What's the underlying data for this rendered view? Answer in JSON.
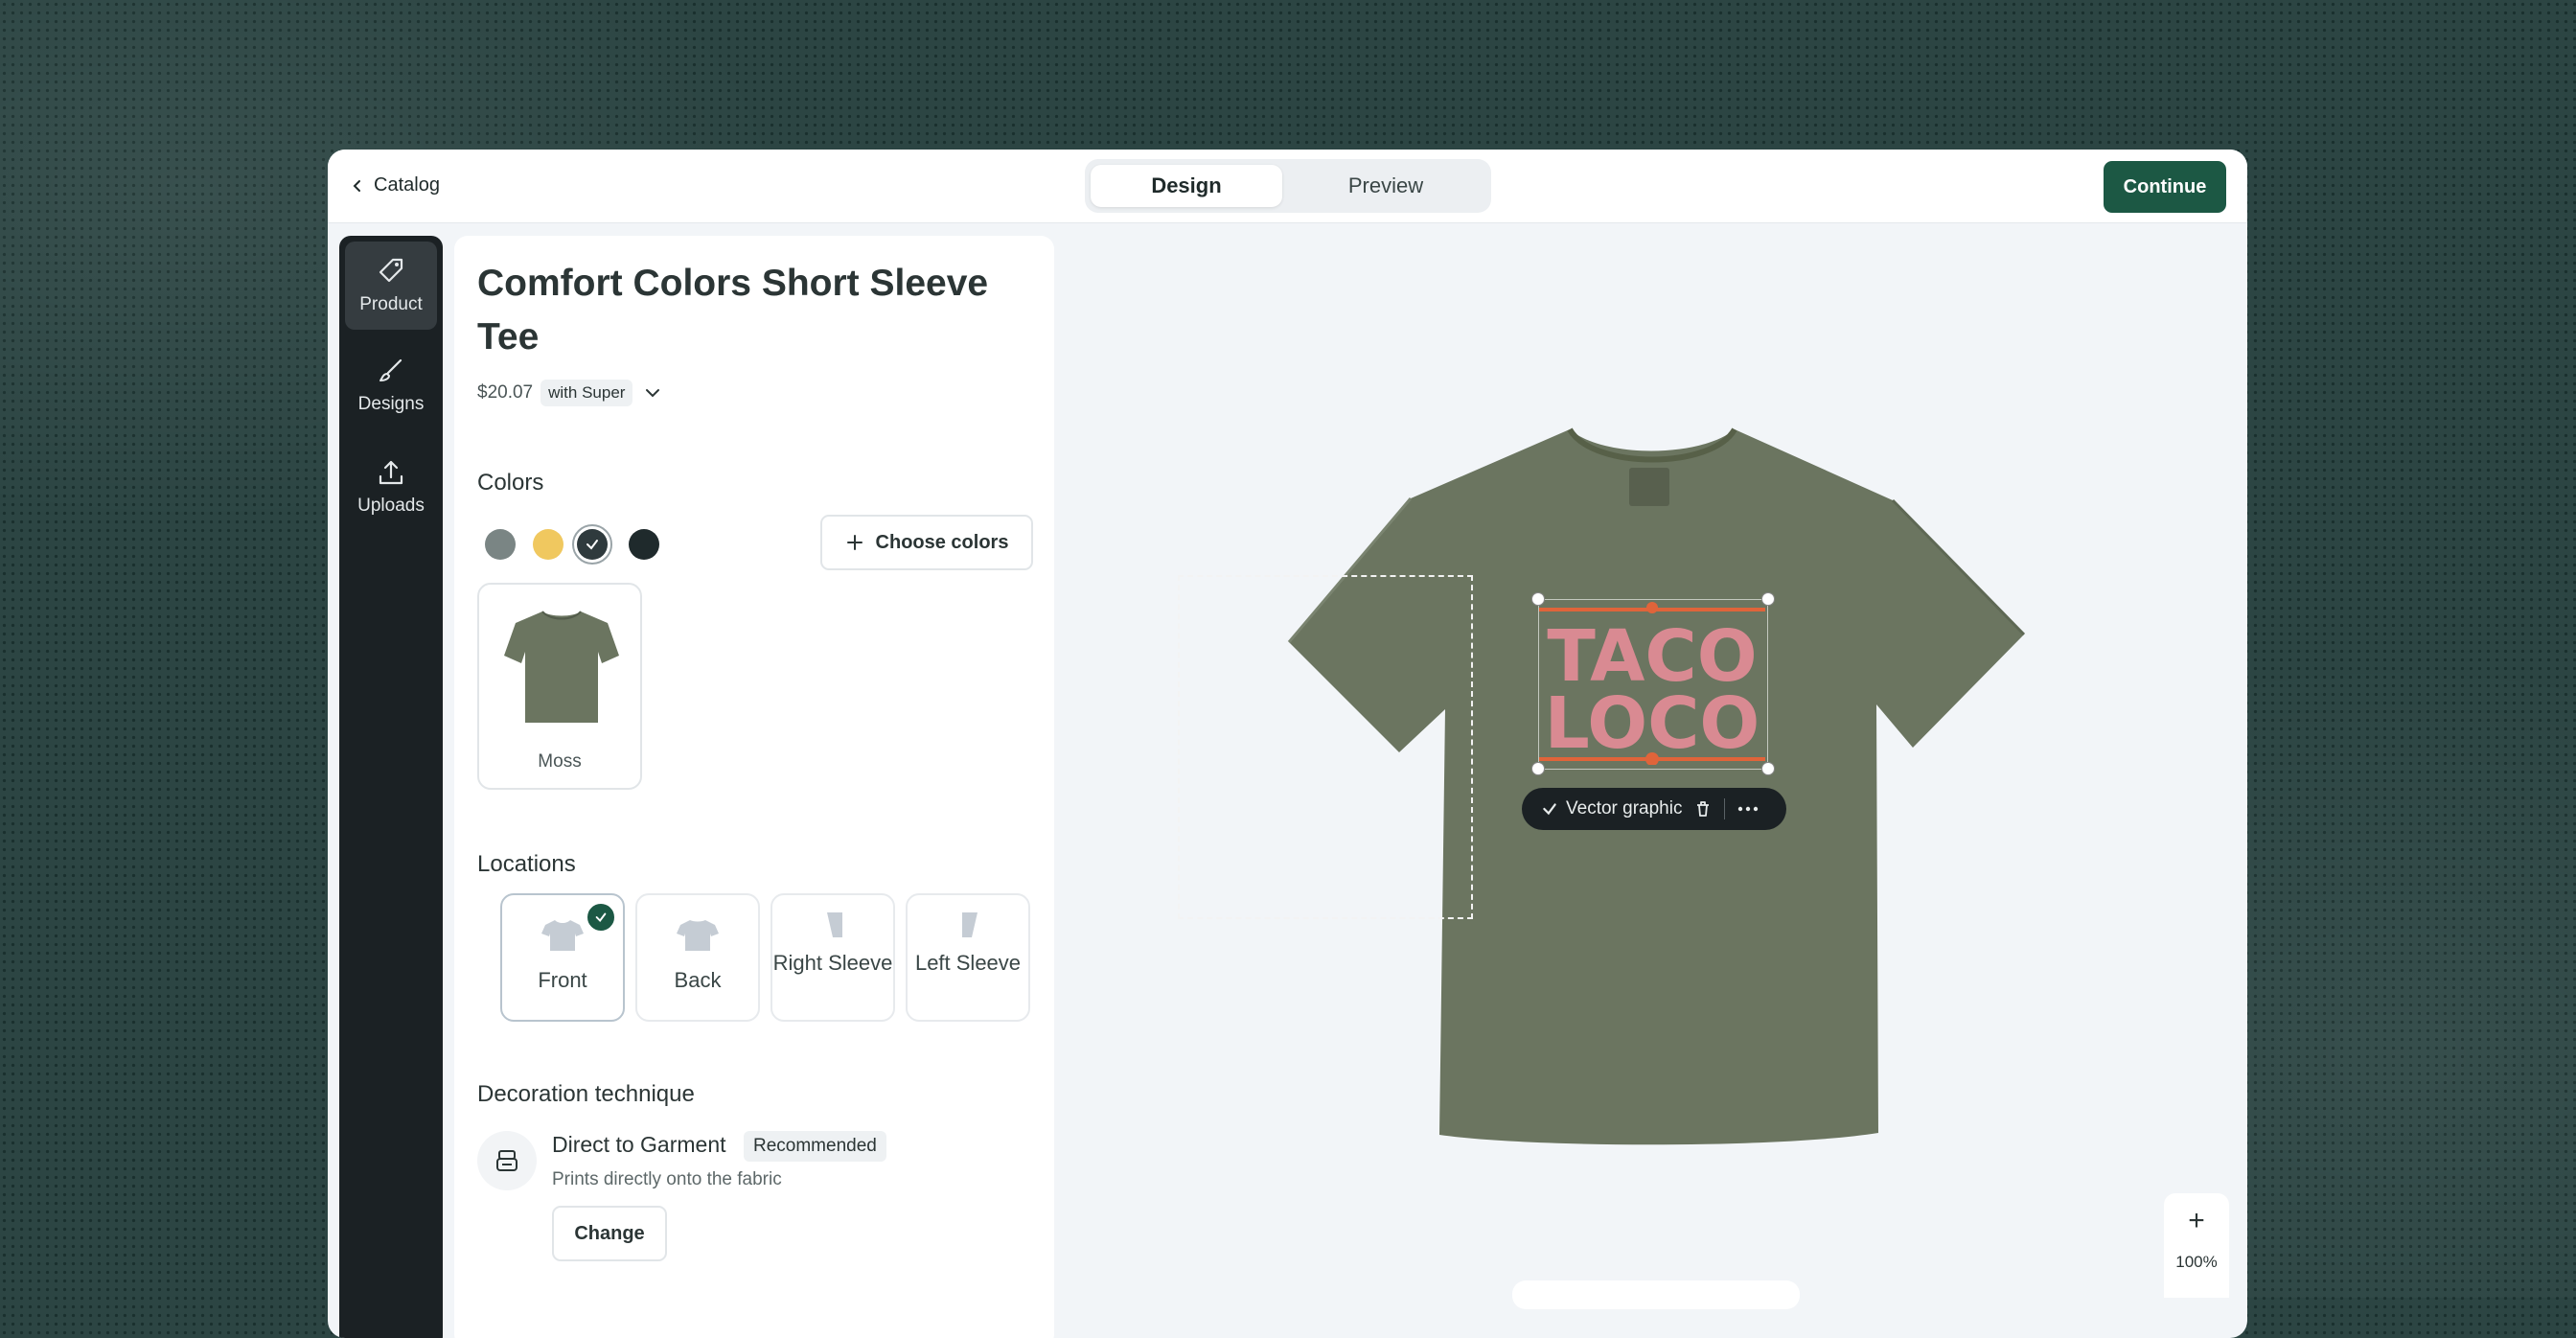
{
  "topbar": {
    "back_label": "Catalog",
    "tabs": [
      {
        "label": "Design",
        "active": true
      },
      {
        "label": "Preview",
        "active": false
      }
    ],
    "continue_label": "Continue"
  },
  "rail": {
    "items": [
      {
        "label": "Product",
        "icon": "tag-icon",
        "active": true
      },
      {
        "label": "Designs",
        "icon": "brush-icon",
        "active": false
      },
      {
        "label": "Uploads",
        "icon": "upload-icon",
        "active": false
      }
    ]
  },
  "product": {
    "title": "Comfort Colors Short Sleeve Tee",
    "price": "$20.07",
    "price_note": "with Super"
  },
  "colors": {
    "heading": "Colors",
    "swatches": [
      {
        "name": "gray",
        "hex": "#7a8584"
      },
      {
        "name": "yellow",
        "hex": "#f0c85f"
      },
      {
        "name": "moss",
        "hex": "#2f3a3d",
        "selected": true
      },
      {
        "name": "dark",
        "hex": "#1f2a2c"
      }
    ],
    "choose_label": "Choose colors",
    "selected_color_label": "Moss"
  },
  "locations": {
    "heading": "Locations",
    "items": [
      {
        "label": "Front",
        "selected": true
      },
      {
        "label": "Back",
        "selected": false
      },
      {
        "label": "Right Sleeve",
        "selected": false
      },
      {
        "label": "Left Sleeve",
        "selected": false
      }
    ]
  },
  "decoration": {
    "heading": "Decoration technique",
    "name": "Direct to Garment",
    "badge": "Recommended",
    "description": "Prints directly onto the fabric",
    "change_label": "Change"
  },
  "canvas": {
    "design_text_line1": "TACO",
    "design_text_line2": "LOCO",
    "toolbar_label": "Vector graphic",
    "zoom_level": "100%",
    "shirt_color": "#6b7560",
    "design_color": "#d98a92",
    "accent_color": "#e0643a"
  }
}
